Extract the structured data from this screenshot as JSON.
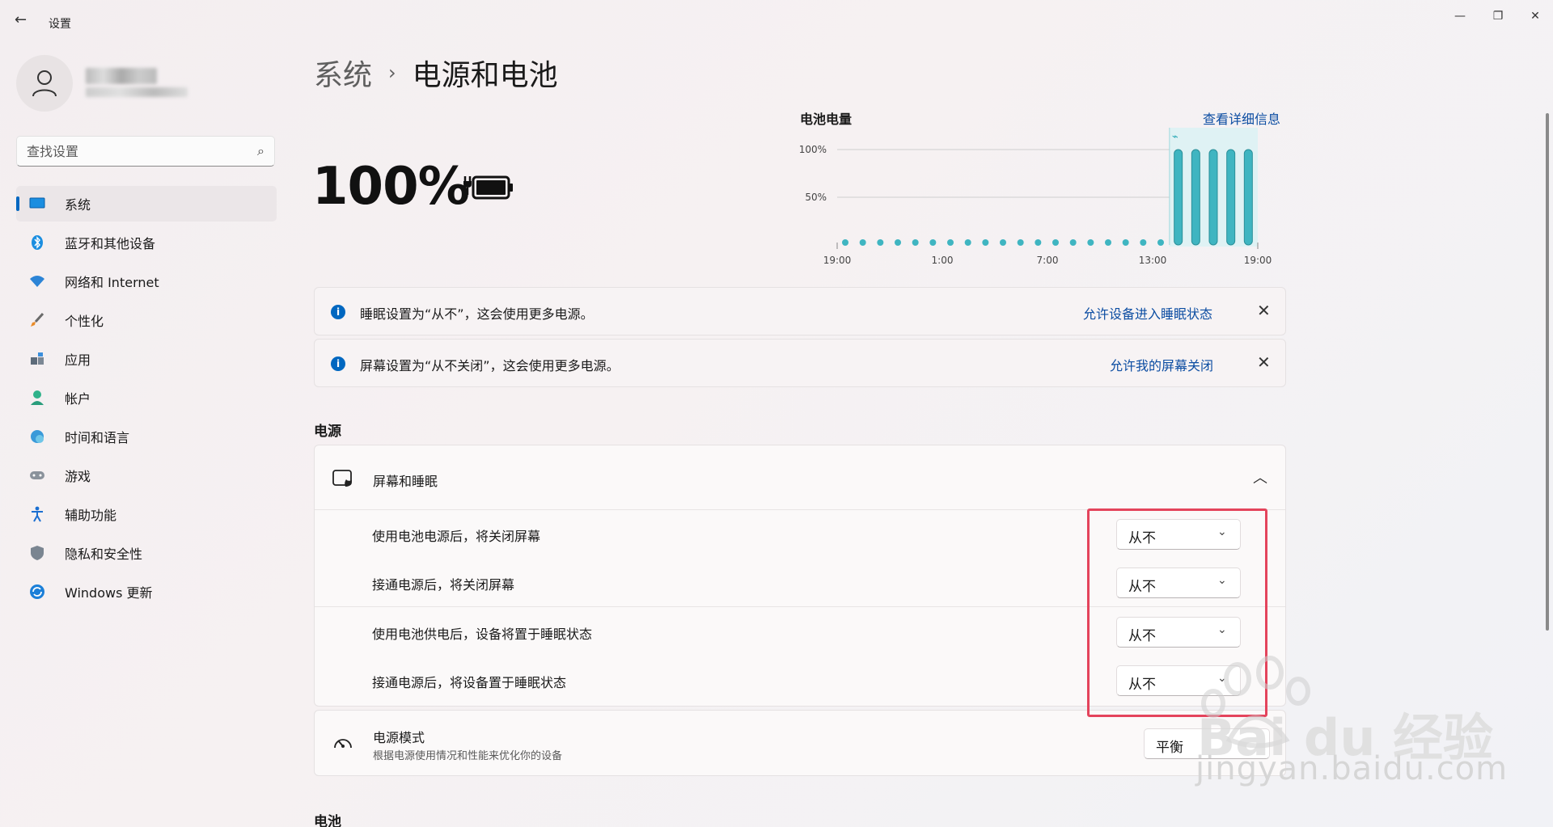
{
  "window": {
    "title": "设置",
    "back_icon": "←",
    "minimize_icon": "—",
    "maximize_icon": "❐",
    "close_icon": "✕"
  },
  "search": {
    "placeholder": "查找设置",
    "icon": "⌕"
  },
  "sidebar": {
    "items": [
      {
        "label": "系统",
        "icon": "monitor-icon",
        "active": true
      },
      {
        "label": "蓝牙和其他设备",
        "icon": "bluetooth-icon"
      },
      {
        "label": "网络和 Internet",
        "icon": "wifi-icon"
      },
      {
        "label": "个性化",
        "icon": "brush-icon"
      },
      {
        "label": "应用",
        "icon": "apps-icon"
      },
      {
        "label": "帐户",
        "icon": "person-icon"
      },
      {
        "label": "时间和语言",
        "icon": "globe-clock-icon"
      },
      {
        "label": "游戏",
        "icon": "gamepad-icon"
      },
      {
        "label": "辅助功能",
        "icon": "accessibility-icon"
      },
      {
        "label": "隐私和安全性",
        "icon": "shield-icon"
      },
      {
        "label": "Windows 更新",
        "icon": "update-icon"
      }
    ]
  },
  "breadcrumb": {
    "parent": "系统",
    "separator": "›",
    "current": "电源和电池"
  },
  "battery": {
    "percent": "100%"
  },
  "chart": {
    "title": "电池电量",
    "details_link": "查看详细信息"
  },
  "chart_data": {
    "type": "bar",
    "title": "电池电量",
    "y_ticks": [
      "100%",
      "50%"
    ],
    "x_ticks": [
      "19:00",
      "1:00",
      "7:00",
      "13:00",
      "19:00"
    ],
    "ylim": [
      0,
      100
    ],
    "points": 24,
    "values": [
      0,
      0,
      0,
      0,
      0,
      0,
      0,
      0,
      0,
      0,
      0,
      0,
      0,
      0,
      0,
      0,
      0,
      0,
      0,
      100,
      100,
      100,
      100,
      100
    ],
    "charging_from_index": 19,
    "color": "#3fb5c1"
  },
  "notices": [
    {
      "text": "睡眠设置为“从不”，这会使用更多电源。",
      "link": "允许设备进入睡眠状态",
      "close": "✕"
    },
    {
      "text": "屏幕设置为“从不关闭”，这会使用更多电源。",
      "link": "允许我的屏幕关闭",
      "close": "✕"
    }
  ],
  "power_section": {
    "label": "电源"
  },
  "screen_sleep": {
    "title": "屏幕和睡眠",
    "chevron": "︿",
    "rows": [
      {
        "label": "使用电池电源后，将关闭屏幕",
        "value": "从不"
      },
      {
        "label": "接通电源后，将关闭屏幕",
        "value": "从不"
      },
      {
        "label": "使用电池供电后，设备将置于睡眠状态",
        "value": "从不"
      },
      {
        "label": "接通电源后，将设备置于睡眠状态",
        "value": "从不"
      }
    ],
    "dropdown_chevron": "⌄"
  },
  "power_mode": {
    "title": "电源模式",
    "subtitle": "根据电源使用情况和性能来优化你的设备",
    "value": "平衡"
  },
  "battery_section": {
    "label": "电池"
  },
  "watermark": {
    "text": "jingyan.baidu.com",
    "brand": "Bai du 经验"
  },
  "colors": {
    "accent": "#0067c0",
    "link": "#0c4da2",
    "highlight": "#e4445c",
    "chart": "#3fb5c1"
  }
}
